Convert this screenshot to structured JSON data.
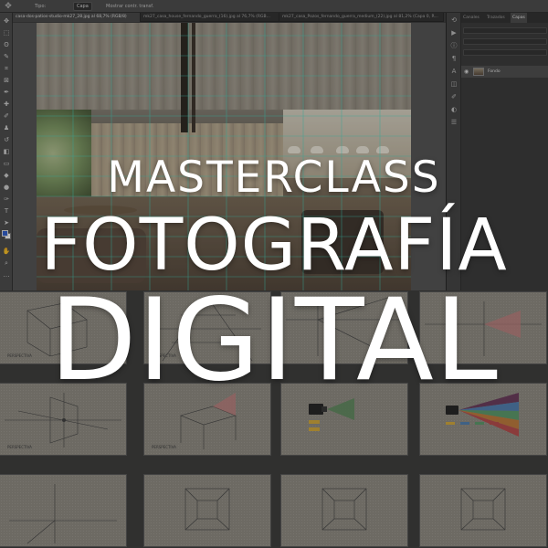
{
  "title": {
    "line1": "MASTERCLASS",
    "line2": "FOTOGRAFÍA",
    "line3": "DIGITAL"
  },
  "photoshop": {
    "options_bar": {
      "tool_icon": "move-tool-icon",
      "mode_label": "Tipo:",
      "mode_value": "Capa",
      "extra_label": "Mostrar contr. transf."
    },
    "doc_tabs": [
      {
        "label": "casa-dos-patios-studio-mk27_28.jpg al 68,7% (RGB/8)",
        "active": true
      },
      {
        "label": "mk27_casa_house_fernando_guerra_(16).jpg al 76,7% (RGB...",
        "active": false
      },
      {
        "label": "mk27_casa_Pozos_fernando_guerra_medium_(22).jpg al 81,2% (Capa 0, R...",
        "active": false
      }
    ],
    "panel_tabs": [
      {
        "label": "Canales",
        "active": false
      },
      {
        "label": "Trazados",
        "active": false
      },
      {
        "label": "Capas",
        "active": true
      }
    ],
    "layer": {
      "name": "Fondo"
    },
    "colors": {
      "foreground": "#2f5fd0",
      "background": "#ffffff",
      "accent": "#3ee0c8"
    }
  },
  "thumbnails": [
    {
      "row": 0,
      "col": 0,
      "diagram": "perspective-box",
      "label": "PERSPECTIVA"
    },
    {
      "row": 0,
      "col": 1,
      "diagram": "perspective-lines",
      "label": "PERSPECTIVA"
    },
    {
      "row": 0,
      "col": 2,
      "diagram": "perspective-lines",
      "label": ""
    },
    {
      "row": 0,
      "col": 3,
      "diagram": "perspective-lines-red",
      "label": ""
    },
    {
      "row": 1,
      "col": 0,
      "diagram": "lens-diagram",
      "label": "PERSPECTIVA"
    },
    {
      "row": 1,
      "col": 1,
      "diagram": "perspective-box-red",
      "label": "PERSPECTIVA"
    },
    {
      "row": 1,
      "col": 2,
      "diagram": "camera-cone-green",
      "label": ""
    },
    {
      "row": 1,
      "col": 3,
      "diagram": "camera-fan-color",
      "label": ""
    },
    {
      "row": 2,
      "col": 0,
      "diagram": "axis-lines",
      "label": ""
    },
    {
      "row": 2,
      "col": 1,
      "diagram": "interior-room",
      "label": ""
    },
    {
      "row": 2,
      "col": 2,
      "diagram": "interior-room",
      "label": ""
    },
    {
      "row": 2,
      "col": 3,
      "diagram": "interior-room",
      "label": ""
    }
  ]
}
